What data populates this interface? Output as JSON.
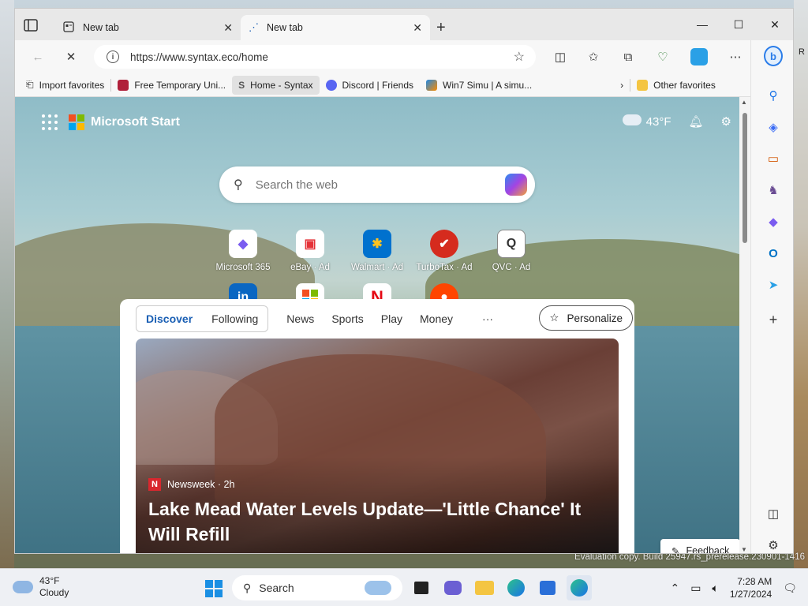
{
  "desktop": {
    "eval_text": "Evaluation copy. Build 25947.rs_prerelease.230901-1416",
    "right_char": "R"
  },
  "browser": {
    "tabs": [
      {
        "label": "New tab"
      },
      {
        "label": "New tab"
      }
    ],
    "address": {
      "url": "https://www.syntax.eco/home"
    },
    "favorites": [
      {
        "label": "Import favorites"
      },
      {
        "label": "Free Temporary Uni..."
      },
      {
        "label": "Home - Syntax"
      },
      {
        "label": "Discord | Friends"
      },
      {
        "label": "Win7 Simu | A simu..."
      },
      {
        "label": "Other favorites"
      }
    ]
  },
  "page": {
    "brand": "Microsoft Start",
    "weather": "43°F",
    "search_placeholder": "Search the web",
    "tiles": [
      {
        "label": "Microsoft 365",
        "icon": "◆",
        "color": "#7a5cf0"
      },
      {
        "label": "eBay · Ad",
        "icon": "🛍",
        "color": "#e53238"
      },
      {
        "label": "Walmart · Ad",
        "icon": "✱",
        "color": "#0071ce"
      },
      {
        "label": "TurboTax · Ad",
        "icon": "✔",
        "color": "#d52b1e"
      },
      {
        "label": "QVC · Ad",
        "icon": "Q",
        "color": "#333333"
      }
    ],
    "tiles_row2": [
      {
        "label": "in",
        "color": "#0a66c2"
      },
      {
        "label": "▦",
        "color": "#f25022"
      },
      {
        "label": "N",
        "color": "#e50914"
      },
      {
        "label": "●",
        "color": "#ff4500"
      }
    ],
    "feed": {
      "tab_discover": "Discover",
      "tab_following": "Following",
      "tabs": [
        "News",
        "Sports",
        "Play",
        "Money"
      ],
      "more": "···",
      "personalize": "Personalize",
      "source": "Newsweek · 2h",
      "headline": "Lake Mead Water Levels Update—'Little Chance' It Will Refill"
    },
    "feedback": "Feedback"
  },
  "taskbar": {
    "weather_temp": "43°F",
    "weather_desc": "Cloudy",
    "search_label": "Search",
    "time": "7:28 AM",
    "date": "1/27/2024"
  },
  "colors": {
    "ms_red": "#f25022",
    "ms_green": "#7fba00",
    "ms_blue": "#00a4ef",
    "ms_yellow": "#ffb900",
    "edge_blue": "#1a5fb4"
  }
}
